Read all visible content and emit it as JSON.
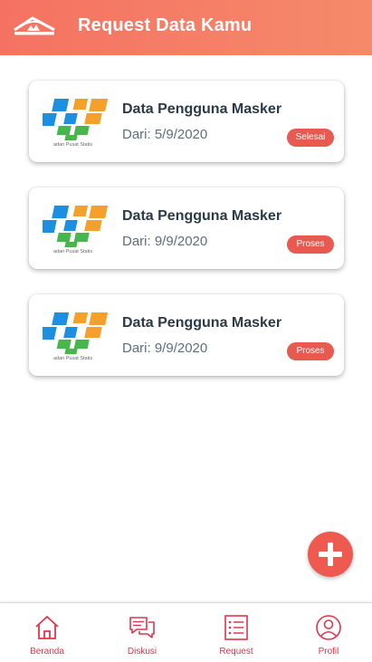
{
  "header": {
    "title": "Request Data Kamu",
    "accent": "#f57262",
    "logo_icon": "red-house-logo-icon"
  },
  "requests": [
    {
      "title": "Data Pengguna Masker",
      "date": "Dari: 5/9/2020",
      "status": "Selesai",
      "logo_text": "adan Pusat Statis",
      "logo_icon": "bps-logo-icon"
    },
    {
      "title": "Data Pengguna Masker",
      "date": "Dari: 9/9/2020",
      "status": "Proses",
      "logo_text": "adan Pusat Statis",
      "logo_icon": "bps-logo-icon"
    },
    {
      "title": "Data Pengguna Masker",
      "date": "Dari: 9/9/2020",
      "status": "Proses",
      "logo_text": "adan Pusat Statis",
      "logo_icon": "bps-logo-icon"
    }
  ],
  "fab": {
    "icon": "plus-icon",
    "color": "#ee5a4f"
  },
  "bottom_nav": [
    {
      "label": "Beranda",
      "icon": "home-icon"
    },
    {
      "label": "Diskusi",
      "icon": "chat-icon"
    },
    {
      "label": "Request",
      "icon": "list-icon"
    },
    {
      "label": "Profil",
      "icon": "profile-icon"
    }
  ],
  "colors": {
    "badge": "#e85a50",
    "nav_active": "#e0354c",
    "title_text": "#2b3a47"
  }
}
